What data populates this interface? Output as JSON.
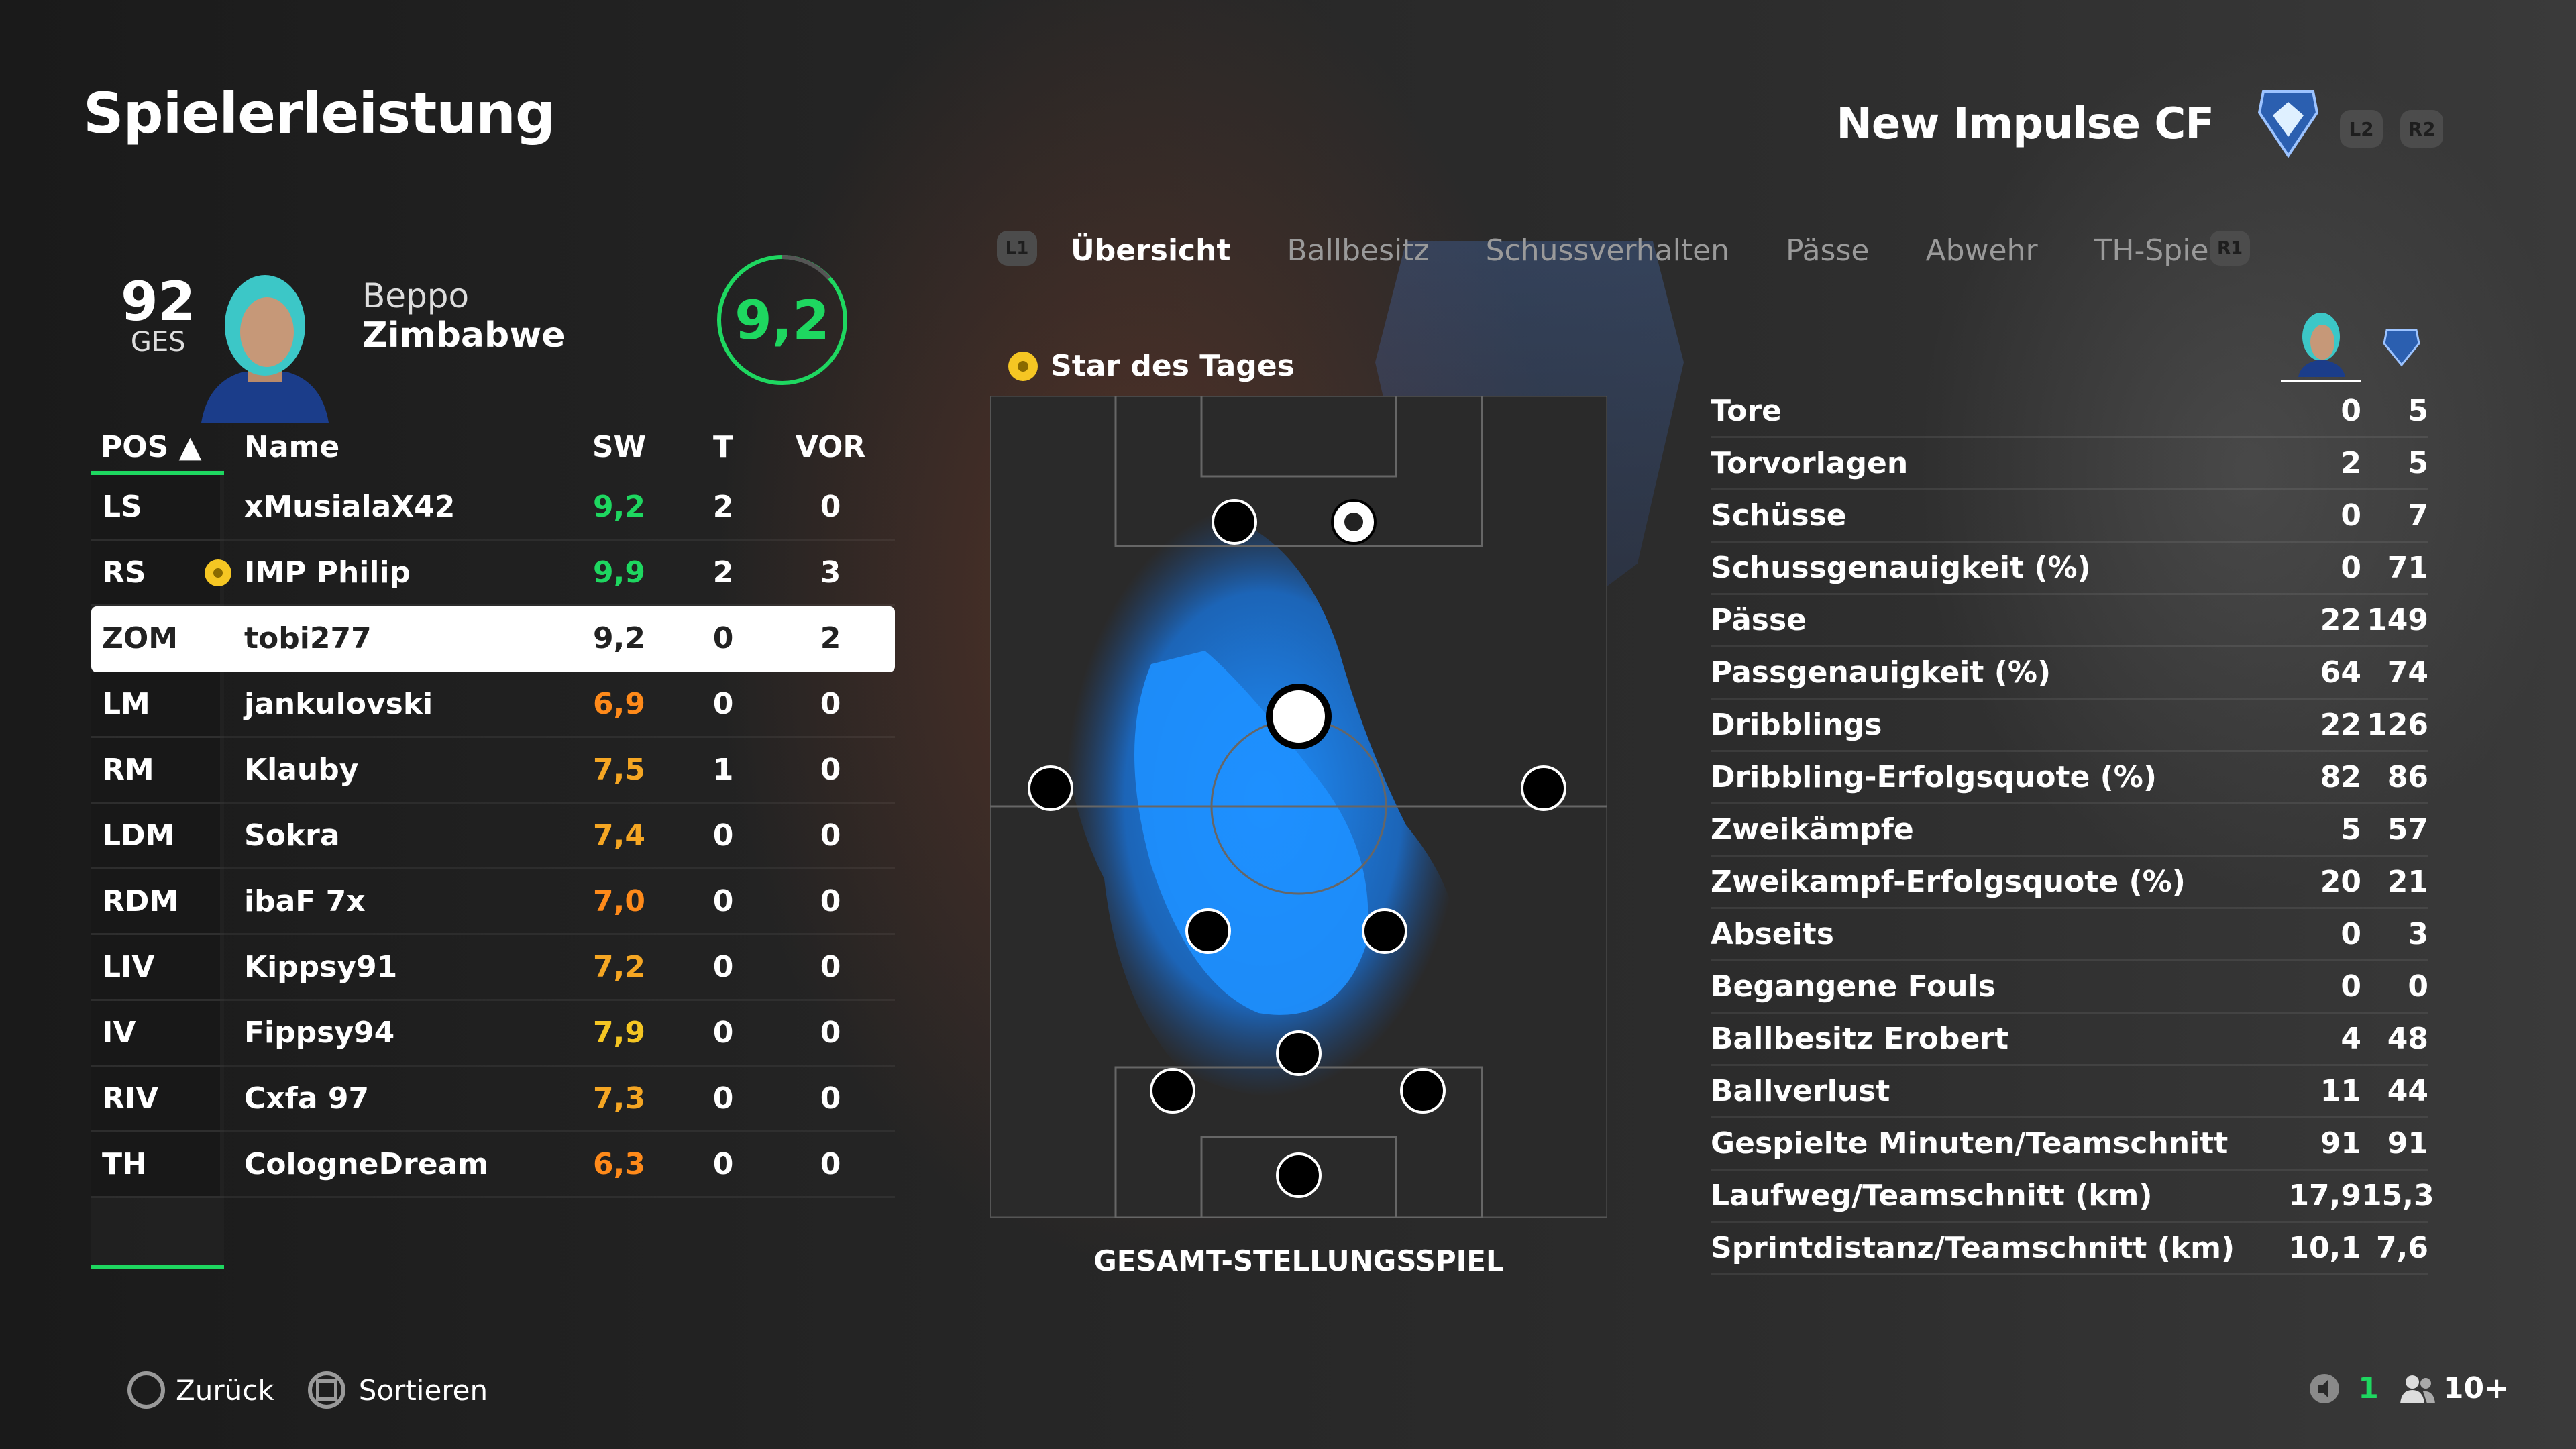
{
  "header": {
    "title": "Spielerleistung",
    "team_name": "New Impulse CF",
    "btn_l2": "L2",
    "btn_r2": "R2"
  },
  "player": {
    "ovr": "92",
    "ovr_label": "GES",
    "first_name": "Beppo",
    "last_name": "Zimbabwe",
    "rating": "9,2"
  },
  "table": {
    "headers": {
      "pos": "POS ▲",
      "name": "Name",
      "sw": "SW",
      "t": "T",
      "vor": "VOR"
    },
    "rows": [
      {
        "pos": "LS",
        "name": "xMusialaX42",
        "sw": "9,2",
        "t": "2",
        "vor": "0",
        "sw_color": "#1ed760"
      },
      {
        "pos": "RS",
        "name": "IMP Philip",
        "sw": "9,9",
        "t": "2",
        "vor": "3",
        "sw_color": "#1ed760"
      },
      {
        "pos": "ZOM",
        "name": "tobi277",
        "sw": "9,2",
        "t": "0",
        "vor": "2",
        "sw_color": "#222222"
      },
      {
        "pos": "LM",
        "name": "jankulovski",
        "sw": "6,9",
        "t": "0",
        "vor": "0",
        "sw_color": "#ff8a1a"
      },
      {
        "pos": "RM",
        "name": "Klauby",
        "sw": "7,5",
        "t": "1",
        "vor": "0",
        "sw_color": "#f5a623"
      },
      {
        "pos": "LDM",
        "name": "Sokra",
        "sw": "7,4",
        "t": "0",
        "vor": "0",
        "sw_color": "#f5a623"
      },
      {
        "pos": "RDM",
        "name": "ibaF 7x",
        "sw": "7,0",
        "t": "0",
        "vor": "0",
        "sw_color": "#ff8a1a"
      },
      {
        "pos": "LIV",
        "name": "Kippsy91",
        "sw": "7,2",
        "t": "0",
        "vor": "0",
        "sw_color": "#f5a623"
      },
      {
        "pos": "IV",
        "name": "Fippsy94",
        "sw": "7,9",
        "t": "0",
        "vor": "0",
        "sw_color": "#f5c623"
      },
      {
        "pos": "RIV",
        "name": "Cxfa 97",
        "sw": "7,3",
        "t": "0",
        "vor": "0",
        "sw_color": "#f5a623"
      },
      {
        "pos": "TH",
        "name": "CologneDream",
        "sw": "6,3",
        "t": "0",
        "vor": "0",
        "sw_color": "#ff8a1a"
      }
    ]
  },
  "tabs": {
    "l1": "L1",
    "r1": "R1",
    "items": [
      "Übersicht",
      "Ballbesitz",
      "Schussverhalten",
      "Pässe",
      "Abwehr",
      "TH-Spiel"
    ]
  },
  "pitch": {
    "star_label": "Star des Tages",
    "caption": "GESAMT-STELLUNGSSPIEL"
  },
  "stats": [
    {
      "label": "Tore",
      "a": "0",
      "b": "5"
    },
    {
      "label": "Torvorlagen",
      "a": "2",
      "b": "5"
    },
    {
      "label": "Schüsse",
      "a": "0",
      "b": "7"
    },
    {
      "label": "Schussgenauigkeit (%)",
      "a": "0",
      "b": "71"
    },
    {
      "label": "Pässe",
      "a": "22",
      "b": "149"
    },
    {
      "label": "Passgenauigkeit (%)",
      "a": "64",
      "b": "74"
    },
    {
      "label": "Dribblings",
      "a": "22",
      "b": "126"
    },
    {
      "label": "Dribbling-Erfolgsquote (%)",
      "a": "82",
      "b": "86"
    },
    {
      "label": "Zweikämpfe",
      "a": "5",
      "b": "57"
    },
    {
      "label": "Zweikampf-Erfolgsquote (%)",
      "a": "20",
      "b": "21"
    },
    {
      "label": "Abseits",
      "a": "0",
      "b": "3"
    },
    {
      "label": "Begangene Fouls",
      "a": "0",
      "b": "0"
    },
    {
      "label": "Ballbesitz Erobert",
      "a": "4",
      "b": "48"
    },
    {
      "label": "Ballverlust",
      "a": "11",
      "b": "44"
    },
    {
      "label": "Gespielte Minuten/Teamschnitt",
      "a": "91",
      "b": "91"
    },
    {
      "label": "Laufweg/Teamschnitt (km)",
      "a": "17,9",
      "b": "15,3"
    },
    {
      "label": "Sprintdistanz/Teamschnitt (km)",
      "a": "10,1",
      "b": "7,6"
    }
  ],
  "footer": {
    "back": "Zurück",
    "sort": "Sortieren",
    "count_a": "1",
    "count_b": "10+"
  },
  "colors": {
    "accent_green": "#1ed760",
    "heatmap_blue": "#1e90ff"
  }
}
